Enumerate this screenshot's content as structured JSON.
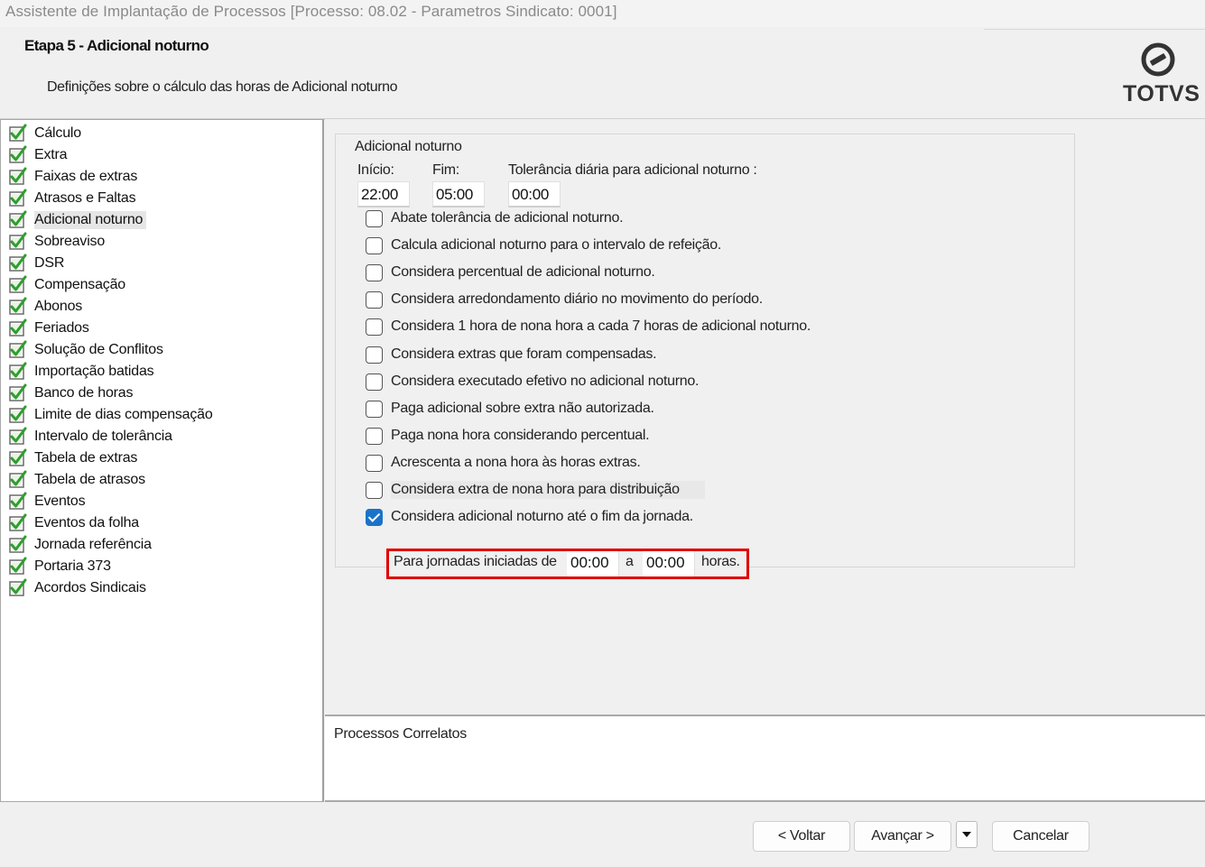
{
  "window": {
    "title": "Assistente de Implantação de Processos [Processo: 08.02 - Parametros Sindicato: 0001]"
  },
  "header": {
    "step_title": "Etapa 5 - Adicional noturno",
    "step_description": "Definições sobre o cálculo das horas de Adicional noturno",
    "logo_text": "TOTVS"
  },
  "sidebar": {
    "items": [
      {
        "label": "Cálculo"
      },
      {
        "label": "Extra"
      },
      {
        "label": "Faixas de extras"
      },
      {
        "label": "Atrasos e Faltas"
      },
      {
        "label": "Adicional noturno",
        "selected": true
      },
      {
        "label": "Sobreaviso"
      },
      {
        "label": "DSR"
      },
      {
        "label": "Compensação"
      },
      {
        "label": "Abonos"
      },
      {
        "label": "Feriados"
      },
      {
        "label": "Solução de Conflitos"
      },
      {
        "label": "Importação batidas"
      },
      {
        "label": "Banco de horas"
      },
      {
        "label": "Limite de dias compensação"
      },
      {
        "label": "Intervalo de tolerância"
      },
      {
        "label": "Tabela de extras"
      },
      {
        "label": "Tabela de atrasos"
      },
      {
        "label": "Eventos"
      },
      {
        "label": "Eventos da folha"
      },
      {
        "label": "Jornada referência"
      },
      {
        "label": "Portaria 373"
      },
      {
        "label": "Acordos Sindicais"
      }
    ]
  },
  "form": {
    "group_title": "Adicional noturno",
    "inicio_label": "Início:",
    "inicio_value": "22:00",
    "fim_label": "Fim:",
    "fim_value": "05:00",
    "tolerancia_label": "Tolerância diária para adicional noturno :",
    "tolerancia_value": "00:00",
    "checkboxes": [
      {
        "label": "Abate tolerância de adicional noturno.",
        "checked": false
      },
      {
        "label": "Calcula adicional noturno para o intervalo de refeição.",
        "checked": false
      },
      {
        "label": "Considera percentual de adicional noturno.",
        "checked": false
      },
      {
        "label": "Considera arredondamento diário no movimento do período.",
        "checked": false
      },
      {
        "label": "Considera 1 hora de nona hora  a cada 7 horas de adicional noturno.",
        "checked": false
      },
      {
        "label": "Considera extras que foram compensadas.",
        "checked": false
      },
      {
        "label": "Considera executado efetivo no adicional noturno.",
        "checked": false
      },
      {
        "label": "Paga adicional sobre extra não autorizada.",
        "checked": false
      },
      {
        "label": "Paga nona hora considerando percentual.",
        "checked": false
      },
      {
        "label": "Acrescenta a nona hora às horas extras.",
        "checked": false
      },
      {
        "label": "Considera extra de nona hora para distribuição",
        "checked": false
      },
      {
        "label": "Considera adicional noturno até o fim da jornada.",
        "checked": true
      }
    ],
    "range": {
      "prefix": "Para jornadas iniciadas de",
      "from_value": "00:00",
      "between": "a",
      "to_value": "00:00",
      "suffix": "horas."
    }
  },
  "related": {
    "title": "Processos Correlatos"
  },
  "footer": {
    "back_label": "< Voltar",
    "next_label": "Avançar >",
    "cancel_label": "Cancelar"
  },
  "colors": {
    "checkbox_checked": "#1a73c9",
    "highlight_border": "#e00000",
    "sidebar_check": "#2e9e2e"
  }
}
